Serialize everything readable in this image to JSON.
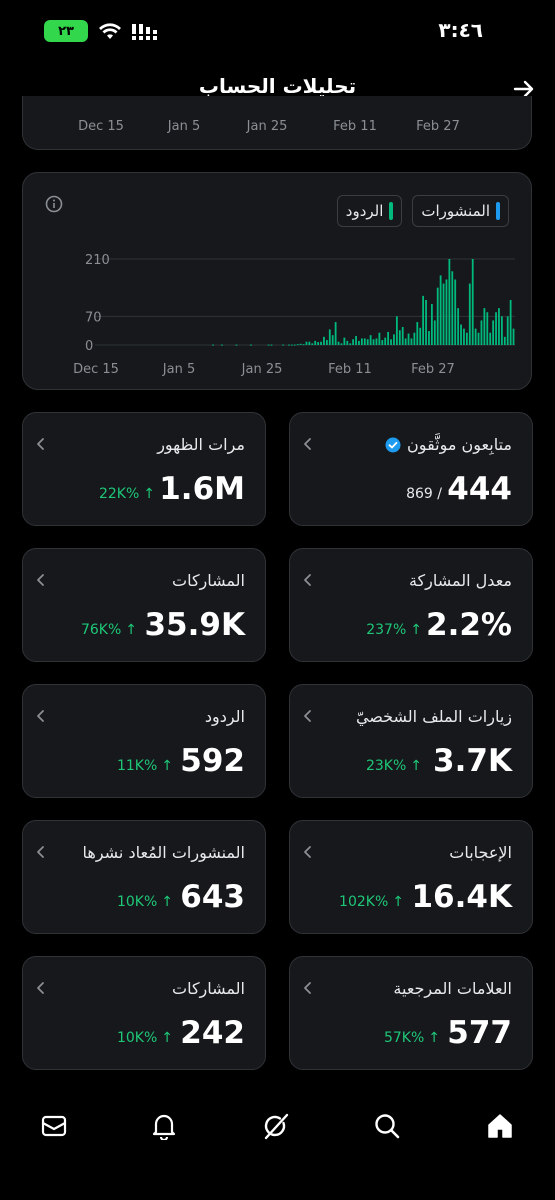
{
  "status_bar": {
    "time": "٣:٤٦",
    "battery": "٢٣"
  },
  "header": {
    "title": "تحليلات الحساب"
  },
  "top_chart_axis": [
    "Dec 15",
    "Jan 5",
    "Jan 25",
    "Feb 11",
    "Feb 27"
  ],
  "legend": {
    "posts_label": "المنشورات",
    "replies_label": "الردود",
    "posts_color": "#1d9bf0",
    "replies_color": "#00ba7c"
  },
  "chart_data": {
    "type": "bar",
    "x_ticks": [
      "Dec 15",
      "Jan 5",
      "Jan 25",
      "Feb 11",
      "Feb 27"
    ],
    "y_ticks": [
      0,
      70,
      210
    ],
    "ylim": [
      0,
      210
    ],
    "grid": true,
    "series": [
      {
        "name": "الردود",
        "color": "#00ba7c",
        "values": [
          0,
          0,
          0,
          0,
          0,
          0,
          0,
          0,
          0,
          0,
          0,
          0,
          0,
          0,
          0,
          0,
          0,
          0,
          0,
          0,
          0,
          0,
          0,
          0,
          0,
          0,
          0,
          0,
          0,
          0,
          0,
          0,
          0,
          0,
          0,
          0,
          0,
          0,
          0,
          0,
          1,
          0,
          0,
          1,
          0,
          0,
          0,
          0,
          1,
          0,
          0,
          0,
          0,
          1,
          0,
          0,
          0,
          0,
          0,
          1,
          1,
          0,
          0,
          0,
          1,
          0,
          1,
          1,
          1,
          2,
          3,
          2,
          8,
          8,
          4,
          10,
          7,
          8,
          20,
          12,
          38,
          24,
          56,
          8,
          4,
          18,
          10,
          4,
          14,
          22,
          10,
          16,
          16,
          14,
          24,
          14,
          16,
          30,
          12,
          18,
          32,
          14,
          26,
          70,
          36,
          44,
          16,
          28,
          16,
          30,
          56,
          42,
          120,
          110,
          34,
          100,
          60,
          140,
          170,
          150,
          160,
          210,
          180,
          160,
          90,
          50,
          40,
          30,
          150,
          210,
          40,
          30,
          60,
          90,
          80,
          30,
          60,
          80,
          90,
          70,
          20,
          70,
          110,
          40
        ]
      }
    ]
  },
  "metrics": [
    {
      "key": "verified_followers",
      "label": "متابِعون موثَّقون",
      "value": "444",
      "sub": "/ 869",
      "change": "",
      "verified": true
    },
    {
      "key": "impressions",
      "label": "مرات الظهور",
      "value": "1.6M",
      "change": "22K%",
      "sub": ""
    },
    {
      "key": "engagement_rate",
      "label": "معدل المشاركة",
      "value": "2.2%",
      "change": "237%",
      "sub": ""
    },
    {
      "key": "engagements",
      "label": "المشاركات",
      "value": "35.9K",
      "change": "76K%",
      "sub": ""
    },
    {
      "key": "profile_visits",
      "label": "زيارات الملف الشخصيّ",
      "value": "3.7K",
      "change": "23K%",
      "sub": ""
    },
    {
      "key": "replies",
      "label": "الردود",
      "value": "592",
      "change": "11K%",
      "sub": ""
    },
    {
      "key": "likes",
      "label": "الإعجابات",
      "value": "16.4K",
      "change": "102K%",
      "sub": ""
    },
    {
      "key": "reposts",
      "label": "المنشورات المُعاد نشرها",
      "value": "643",
      "change": "10K%",
      "sub": ""
    },
    {
      "key": "bookmarks",
      "label": "العلامات المرجعية",
      "value": "577",
      "change": "57K%",
      "sub": ""
    },
    {
      "key": "shares",
      "label": "المشاركات",
      "value": "242",
      "change": "10K%",
      "sub": ""
    }
  ],
  "arrow_glyph": "↑",
  "nav": [
    "home-icon",
    "search-icon",
    "grok-icon",
    "notifications-icon",
    "messages-icon"
  ]
}
